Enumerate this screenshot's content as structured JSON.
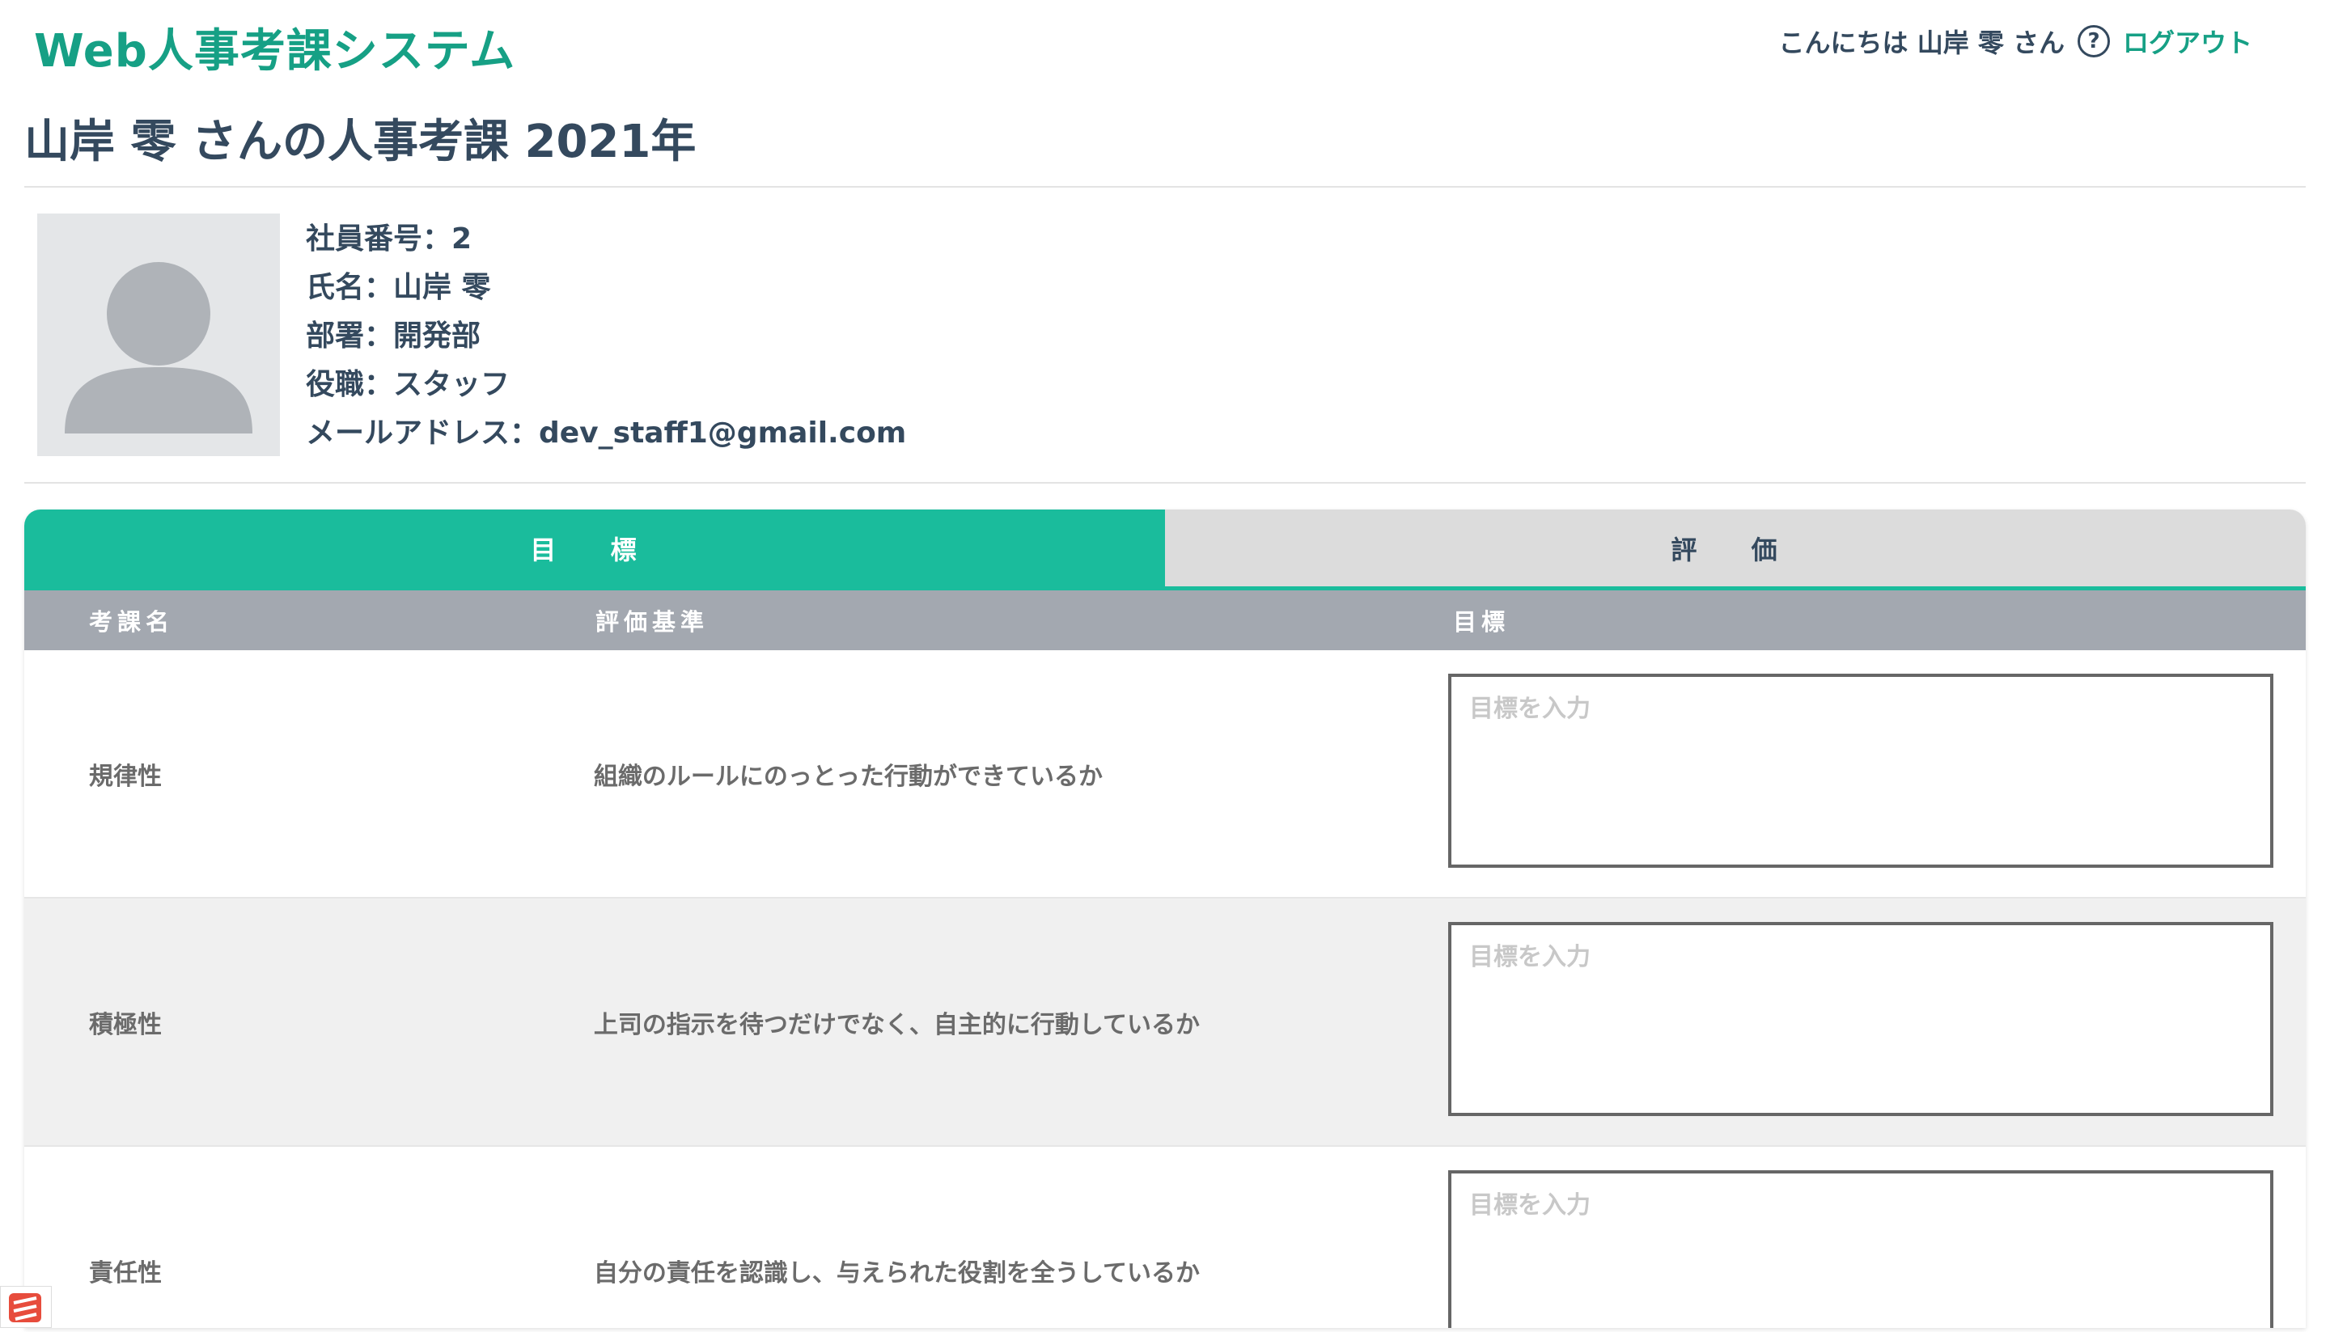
{
  "header": {
    "app_title": "Web人事考課システム",
    "greeting": "こんにちは 山岸 零 さん",
    "help_glyph": "?",
    "logout_label": "ログアウト"
  },
  "page": {
    "title": "山岸 零 さんの人事考課 2021年"
  },
  "profile": {
    "employee_no": "社員番号：2",
    "name": "氏名：山岸 零",
    "department": "部署：開発部",
    "position": "役職：スタッフ",
    "email": "メールアドレス：dev_staff1@gmail.com"
  },
  "tabs": [
    {
      "label": "目 標",
      "active": true
    },
    {
      "label": "評 価",
      "active": false
    }
  ],
  "table": {
    "headers": [
      "考課名",
      "評価基準",
      "目標"
    ],
    "rows": [
      {
        "name": "規律性",
        "criteria": "組織のルールにのっとった行動ができているか",
        "placeholder": "目標を入力"
      },
      {
        "name": "積極性",
        "criteria": "上司の指示を待つだけでなく、自主的に行動しているか",
        "placeholder": "目標を入力"
      },
      {
        "name": "責任性",
        "criteria": "自分の責任を認識し、与えられた役割を全うしているか",
        "placeholder": "目標を入力"
      }
    ]
  },
  "colors": {
    "brand": "#16a085",
    "tab_active": "#1abc9c",
    "tab_inactive": "#dcdcdc",
    "header_row": "#a3a8b0"
  }
}
